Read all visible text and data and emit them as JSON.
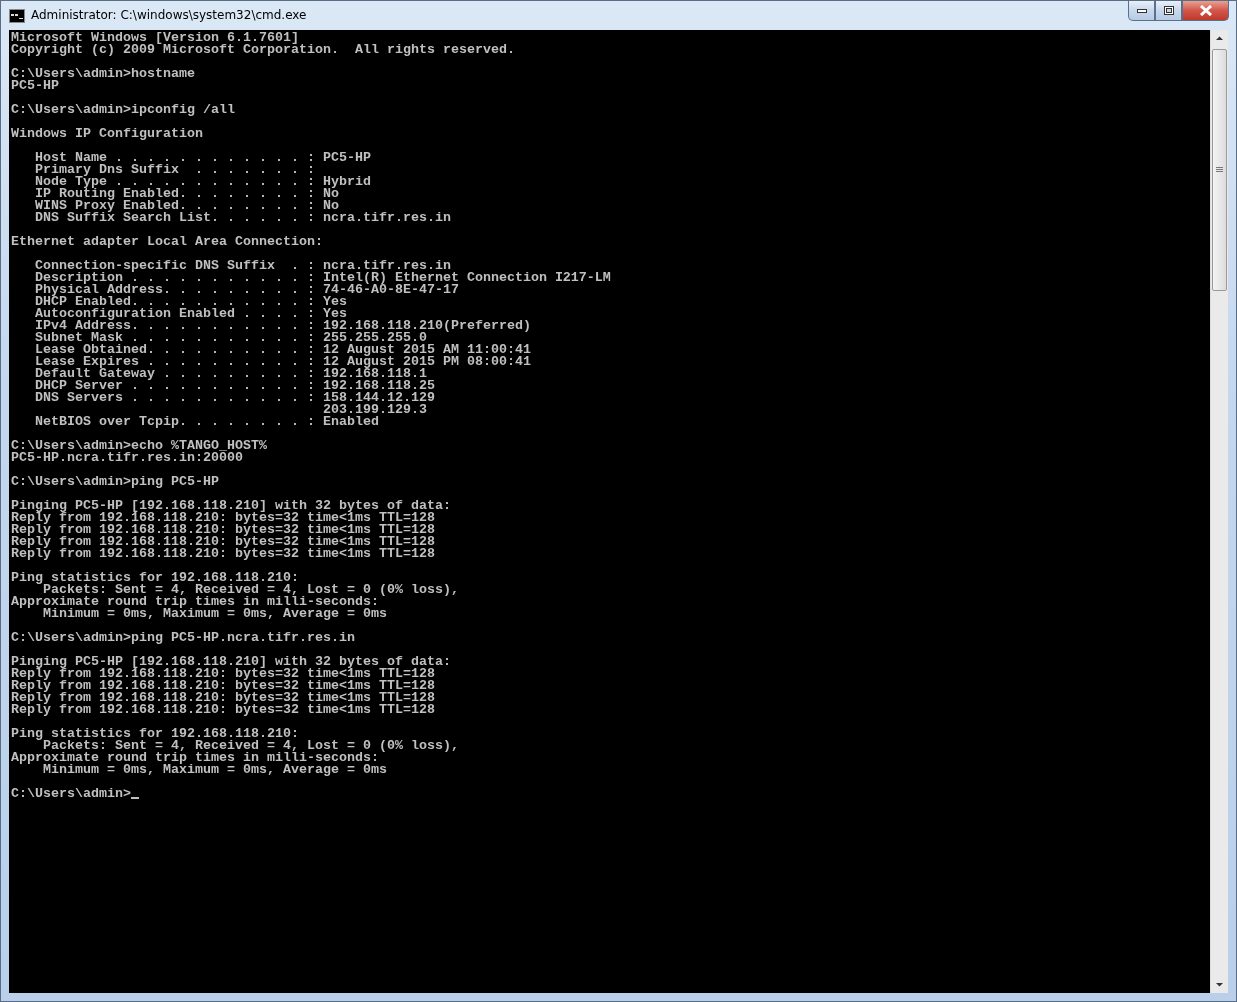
{
  "window": {
    "title": "Administrator: C:\\windows\\system32\\cmd.exe"
  },
  "console": {
    "blocks": [
      [
        "Microsoft Windows [Version 6.1.7601]",
        "Copyright (c) 2009 Microsoft Corporation.  All rights reserved."
      ],
      [
        "C:\\Users\\admin>hostname",
        "PC5-HP"
      ],
      [
        "C:\\Users\\admin>ipconfig /all"
      ],
      [
        "Windows IP Configuration"
      ],
      [
        "   Host Name . . . . . . . . . . . . : PC5-HP",
        "   Primary Dns Suffix  . . . . . . . :",
        "   Node Type . . . . . . . . . . . . : Hybrid",
        "   IP Routing Enabled. . . . . . . . : No",
        "   WINS Proxy Enabled. . . . . . . . : No",
        "   DNS Suffix Search List. . . . . . : ncra.tifr.res.in"
      ],
      [
        "Ethernet adapter Local Area Connection:"
      ],
      [
        "   Connection-specific DNS Suffix  . : ncra.tifr.res.in",
        "   Description . . . . . . . . . . . : Intel(R) Ethernet Connection I217-LM",
        "   Physical Address. . . . . . . . . : 74-46-A0-8E-47-17",
        "   DHCP Enabled. . . . . . . . . . . : Yes",
        "   Autoconfiguration Enabled . . . . : Yes",
        "   IPv4 Address. . . . . . . . . . . : 192.168.118.210(Preferred)",
        "   Subnet Mask . . . . . . . . . . . : 255.255.255.0",
        "   Lease Obtained. . . . . . . . . . : 12 August 2015 AM 11:00:41",
        "   Lease Expires . . . . . . . . . . : 12 August 2015 PM 08:00:41",
        "   Default Gateway . . . . . . . . . : 192.168.118.1",
        "   DHCP Server . . . . . . . . . . . : 192.168.118.25",
        "   DNS Servers . . . . . . . . . . . : 158.144.12.129",
        "                                       203.199.129.3",
        "   NetBIOS over Tcpip. . . . . . . . : Enabled"
      ],
      [
        "C:\\Users\\admin>echo %TANGO_HOST%",
        "PC5-HP.ncra.tifr.res.in:20000"
      ],
      [
        "C:\\Users\\admin>ping PC5-HP"
      ],
      [
        "Pinging PC5-HP [192.168.118.210] with 32 bytes of data:",
        "Reply from 192.168.118.210: bytes=32 time<1ms TTL=128",
        "Reply from 192.168.118.210: bytes=32 time<1ms TTL=128",
        "Reply from 192.168.118.210: bytes=32 time<1ms TTL=128",
        "Reply from 192.168.118.210: bytes=32 time<1ms TTL=128"
      ],
      [
        "Ping statistics for 192.168.118.210:",
        "    Packets: Sent = 4, Received = 4, Lost = 0 (0% loss),",
        "Approximate round trip times in milli-seconds:",
        "    Minimum = 0ms, Maximum = 0ms, Average = 0ms"
      ],
      [
        "C:\\Users\\admin>ping PC5-HP.ncra.tifr.res.in"
      ],
      [
        "Pinging PC5-HP [192.168.118.210] with 32 bytes of data:",
        "Reply from 192.168.118.210: bytes=32 time<1ms TTL=128",
        "Reply from 192.168.118.210: bytes=32 time<1ms TTL=128",
        "Reply from 192.168.118.210: bytes=32 time<1ms TTL=128",
        "Reply from 192.168.118.210: bytes=32 time<1ms TTL=128"
      ],
      [
        "Ping statistics for 192.168.118.210:",
        "    Packets: Sent = 4, Received = 4, Lost = 0 (0% loss),",
        "Approximate round trip times in milli-seconds:",
        "    Minimum = 0ms, Maximum = 0ms, Average = 0ms"
      ]
    ],
    "prompt": "C:\\Users\\admin>"
  }
}
